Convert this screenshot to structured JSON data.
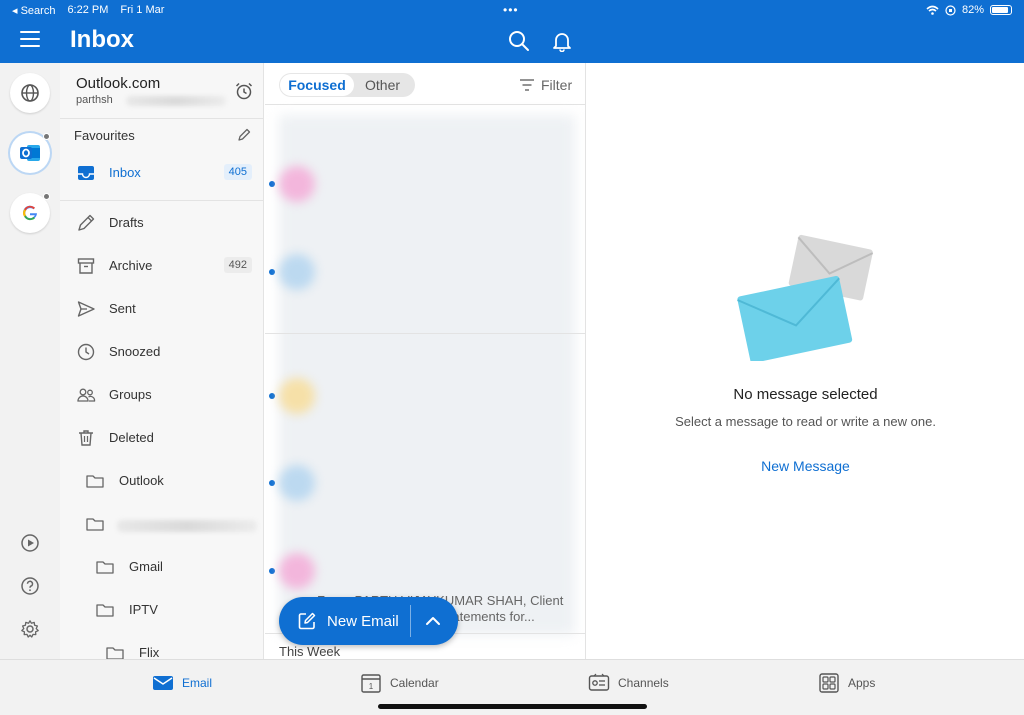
{
  "status_bar": {
    "back_label": "◂ Search",
    "time": "6:22 PM",
    "date": "Fri 1 Mar",
    "dots": "•••",
    "battery": "82%"
  },
  "header": {
    "title": "Inbox"
  },
  "account": {
    "name": "Outlook.com",
    "user": "parthsh"
  },
  "favourites": {
    "label": "Favourites"
  },
  "folders": [
    {
      "label": "Inbox",
      "count": "405"
    },
    {
      "label": "Drafts"
    },
    {
      "label": "Archive",
      "count": "492"
    },
    {
      "label": "Sent"
    },
    {
      "label": "Snoozed"
    },
    {
      "label": "Groups"
    },
    {
      "label": "Deleted"
    },
    {
      "label": "Outlook"
    },
    {
      "label": ""
    },
    {
      "label": "Gmail"
    },
    {
      "label": "IPTV"
    },
    {
      "label": "Flix"
    }
  ],
  "list": {
    "tab_focused": "Focused",
    "tab_other": "Other",
    "filter_label": "Filter",
    "snippet_line1": "From: PARTH VIJAYKUMAR SHAH, Client",
    "snippet_line2": "...nt statements for...",
    "section": "This Week"
  },
  "new_email": {
    "label": "New Email"
  },
  "reading": {
    "title": "No message selected",
    "hint": "Select a message to read or write a new one.",
    "action": "New Message"
  },
  "tabs": [
    {
      "label": "Email"
    },
    {
      "label": "Calendar"
    },
    {
      "label": "Channels"
    },
    {
      "label": "Apps"
    }
  ],
  "colors": {
    "brand": "#0f6fd2",
    "envelope_front": "#6dd1ea",
    "envelope_back": "#d9d9d9"
  }
}
